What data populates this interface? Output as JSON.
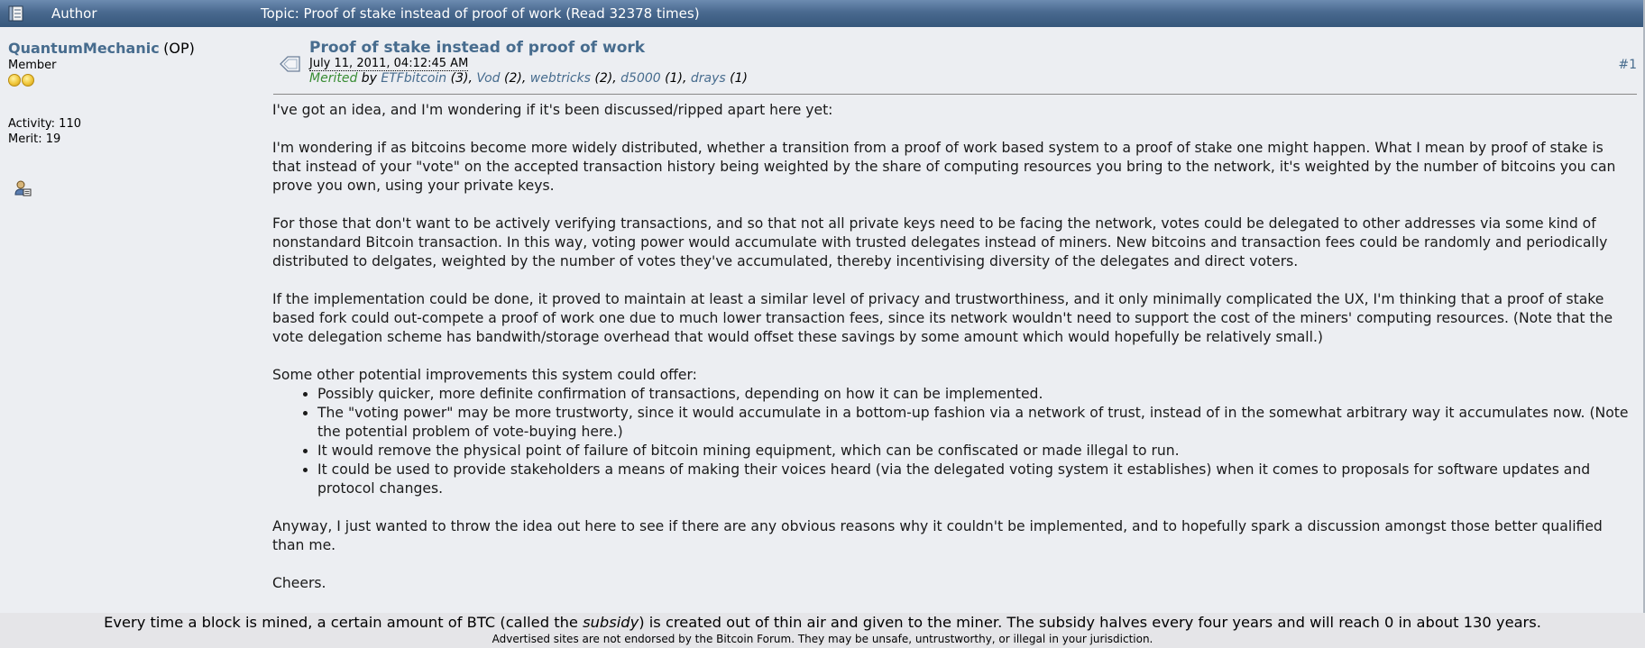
{
  "header": {
    "author_label": "Author",
    "topic_label": "Topic: Proof of stake instead of proof of work  (Read 32378 times)"
  },
  "poster": {
    "name": "QuantumMechanic",
    "op_tag": "(OP)",
    "rank": "Member",
    "activity": "Activity: 110",
    "merit": "Merit: 19",
    "icons": [
      "coin-icon",
      "coin-icon",
      "profile-icon"
    ]
  },
  "post": {
    "title": "Proof of stake instead of proof of work",
    "date": "July 11, 2011, 04:12:45 AM",
    "number": "#1",
    "merited_word": "Merited",
    "merited_by": "by",
    "merit_users": [
      {
        "name": "ETFbitcoin",
        "count": "(3)"
      },
      {
        "name": "Vod",
        "count": "(2)"
      },
      {
        "name": "webtricks",
        "count": "(2)"
      },
      {
        "name": "d5000",
        "count": "(1)"
      },
      {
        "name": "drays",
        "count": "(1)"
      }
    ],
    "paragraphs": [
      "I've got an idea, and I'm wondering if it's been discussed/ripped apart here yet:",
      "I'm wondering if as bitcoins become more widely distributed, whether a transition from a proof of work based system to a proof of stake one might happen.  What I mean by proof of stake is that instead of your \"vote\" on the accepted transaction history being weighted by the share of computing resources you bring to the network, it's weighted by the number of bitcoins you can prove you own, using your private keys.",
      "For those that don't want to be actively verifying transactions, and so that not all private keys need to be facing the network, votes could be delegated to other addresses via some kind of nonstandard Bitcoin transaction.  In this way, voting power would accumulate with trusted delegates instead of miners.  New bitcoins and transaction fees could be randomly and periodically distributed to delgates, weighted by the number of votes they've accumulated, thereby incentivising diversity of the delegates and direct voters.",
      "If the implementation could be done, it proved to maintain at least a similar level of privacy and trustworthiness, and it only minimally complicated the UX, I'm thinking that a proof of stake based fork could out-compete a proof of work one due to much lower transaction fees, since its network wouldn't need to support the cost of the miners' computing resources.  (Note that the vote delegation scheme has bandwith/storage overhead that would offset these savings by some amount which would hopefully be relatively small.)",
      "Some other potential improvements this system could offer:"
    ],
    "bullets": [
      "Possibly quicker, more definite confirmation of transactions, depending on how it can be implemented.",
      "The \"voting power\" may be more trustworty, since it would accumulate in a bottom-up fashion via a network of trust, instead of in the somewhat arbitrary way it accumulates now.  (Note the potential problem of vote-buying here.)",
      "It would remove the physical point of failure of bitcoin mining equipment, which can be confiscated or made illegal to run.",
      "It could be used to provide stakeholders a means of making their voices heard (via the delegated voting system it establishes) when it comes to proposals for software updates and protocol changes."
    ],
    "closing": [
      "Anyway, I just wanted to throw the idea out here to see if there are any obvious reasons why it couldn't be implemented, and to hopefully spark a discussion amongst those better qualified than me.",
      "Cheers."
    ]
  },
  "footer": {
    "fact_before": "Every time a block is mined, a certain amount of BTC (called the ",
    "fact_em": "subsidy",
    "fact_after": ") is created out of thin air and given to the miner. The subsidy halves every four years and will reach 0 in about 130 years.",
    "disclaimer": "Advertised sites are not endorsed by the Bitcoin Forum. They may be unsafe, untrustworthy, or illegal in your jurisdiction."
  },
  "colors": {
    "header_bar": "#49698f",
    "link": "#476c8e",
    "merited_green": "#3a8d35",
    "post_bg": "#eceef2"
  }
}
